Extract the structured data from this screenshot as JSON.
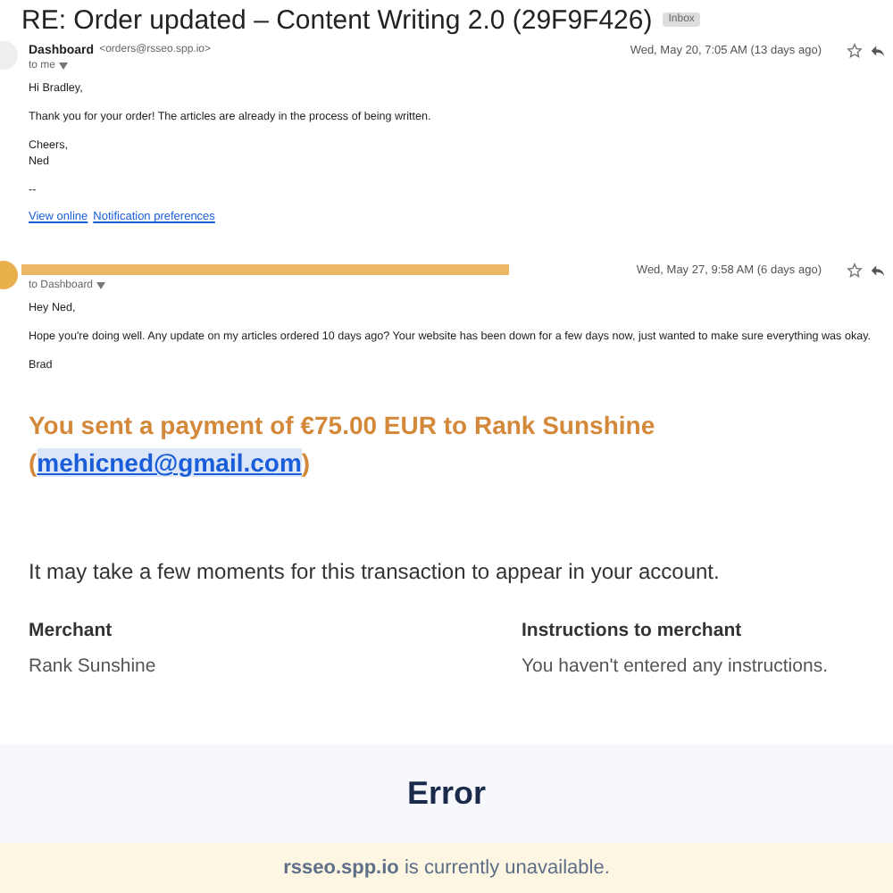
{
  "thread_title": "RE: Order updated – Content Writing 2.0 (29F9F426)",
  "thread_label": "Inbox",
  "emails": [
    {
      "sender": "Dashboard",
      "sender_email": "<orders@rsseo.spp.io>",
      "redacted": false,
      "recipient": "to me",
      "date": "Wed, May 20, 7:05 AM (13 days ago)",
      "paragraphs": [
        "Hi Bradley,",
        "Thank you for your order! The articles are already in the process of being written.",
        "Cheers,\nNed",
        "--"
      ],
      "links": [
        "View online",
        "Notification preferences"
      ]
    },
    {
      "redacted": true,
      "recipient": "to Dashboard",
      "date": "Wed, May 27, 9:58 AM (6 days ago)",
      "paragraphs": [
        "Hey Ned,",
        "Hope you're doing well. Any update on my articles ordered 10 days ago? Your website has been down for a few days now, just wanted to make sure everything was okay.",
        "Brad"
      ]
    }
  ],
  "payment": {
    "heading": "You sent a payment of €75.00 EUR to Rank Sunshine",
    "email_open": "(",
    "email": "mehicned@gmail.com",
    "email_close": ")",
    "note": "It may take a few moments for this transaction to appear in your account.",
    "details": [
      {
        "label": "Merchant",
        "value": "Rank Sunshine"
      },
      {
        "label": "Instructions to merchant",
        "value": "You haven't entered any instructions."
      }
    ]
  },
  "error": {
    "title": "Error",
    "message": "**rsseo.spp.io** is currently unavailable."
  }
}
